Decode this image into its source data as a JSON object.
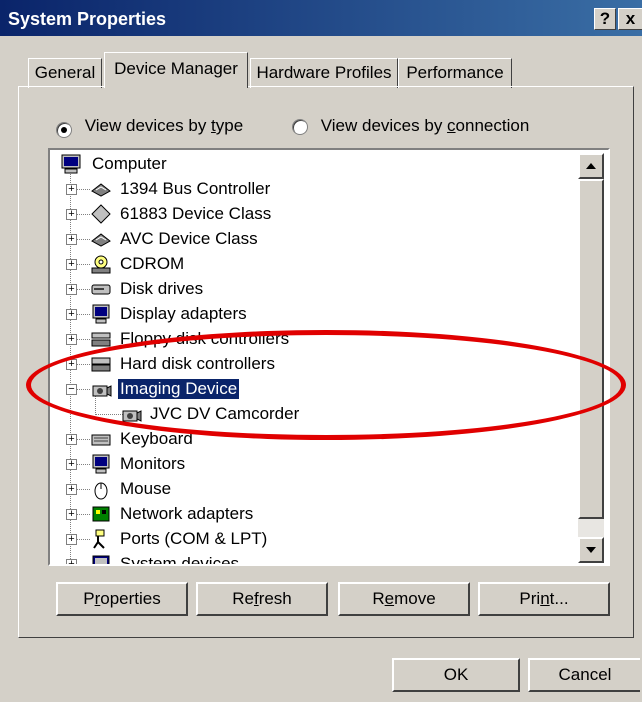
{
  "window": {
    "title": "System Properties",
    "help_glyph": "?",
    "close_glyph": "x"
  },
  "tabs": [
    {
      "label": "General"
    },
    {
      "label": "Device Manager",
      "active": true
    },
    {
      "label": "Hardware Profiles"
    },
    {
      "label": "Performance"
    }
  ],
  "view_options": {
    "by_type": {
      "before": "View devices by ",
      "accel": "t",
      "after": "ype",
      "selected": true
    },
    "by_connection": {
      "before": "View devices by ",
      "accel": "c",
      "after": "onnection",
      "selected": false
    }
  },
  "tree": {
    "root": {
      "label": "Computer",
      "icon": "computer-icon"
    },
    "items": [
      {
        "label": "1394 Bus Controller",
        "icon": "bus-controller-icon",
        "expander": "+"
      },
      {
        "label": "61883 Device Class",
        "icon": "diamond-device-icon",
        "expander": "+"
      },
      {
        "label": "AVC Device Class",
        "icon": "bus-controller-icon",
        "expander": "+"
      },
      {
        "label": "CDROM",
        "icon": "cdrom-icon",
        "expander": "+"
      },
      {
        "label": "Disk drives",
        "icon": "disk-drive-icon",
        "expander": "+"
      },
      {
        "label": "Display adapters",
        "icon": "monitor-icon",
        "expander": "+"
      },
      {
        "label": "Floppy disk controllers",
        "icon": "floppy-controller-icon",
        "expander": "+"
      },
      {
        "label": "Hard disk controllers",
        "icon": "hard-disk-controller-icon",
        "expander": "+"
      },
      {
        "label": "Imaging Device",
        "icon": "imaging-device-icon",
        "expander": "−",
        "selected": true
      },
      {
        "label": "JVC DV Camcorder",
        "icon": "camcorder-icon",
        "child": true
      },
      {
        "label": "Keyboard",
        "icon": "keyboard-icon",
        "expander": "+"
      },
      {
        "label": "Monitors",
        "icon": "monitor-icon",
        "expander": "+"
      },
      {
        "label": "Mouse",
        "icon": "mouse-icon",
        "expander": "+"
      },
      {
        "label": "Network adapters",
        "icon": "network-adapter-icon",
        "expander": "+"
      },
      {
        "label": "Ports (COM & LPT)",
        "icon": "port-icon",
        "expander": "+"
      },
      {
        "label": "System devices",
        "icon": "system-devices-icon",
        "expander": "+"
      }
    ]
  },
  "buttons": {
    "properties": {
      "before": "P",
      "accel": "r",
      "after": "operties"
    },
    "refresh": {
      "before": "Re",
      "accel": "f",
      "after": "resh"
    },
    "remove": {
      "before": "R",
      "accel": "e",
      "after": "move"
    },
    "print": {
      "before": "Pri",
      "accel": "n",
      "after": "t..."
    },
    "ok": {
      "label": "OK"
    },
    "cancel": {
      "label": "Cancel"
    }
  },
  "annotation": {
    "color": "#e00000",
    "shape": "ellipse"
  },
  "colors": {
    "face": "#d4d0c8",
    "titlebar": "#0a246a",
    "selection": "#0a246a"
  }
}
